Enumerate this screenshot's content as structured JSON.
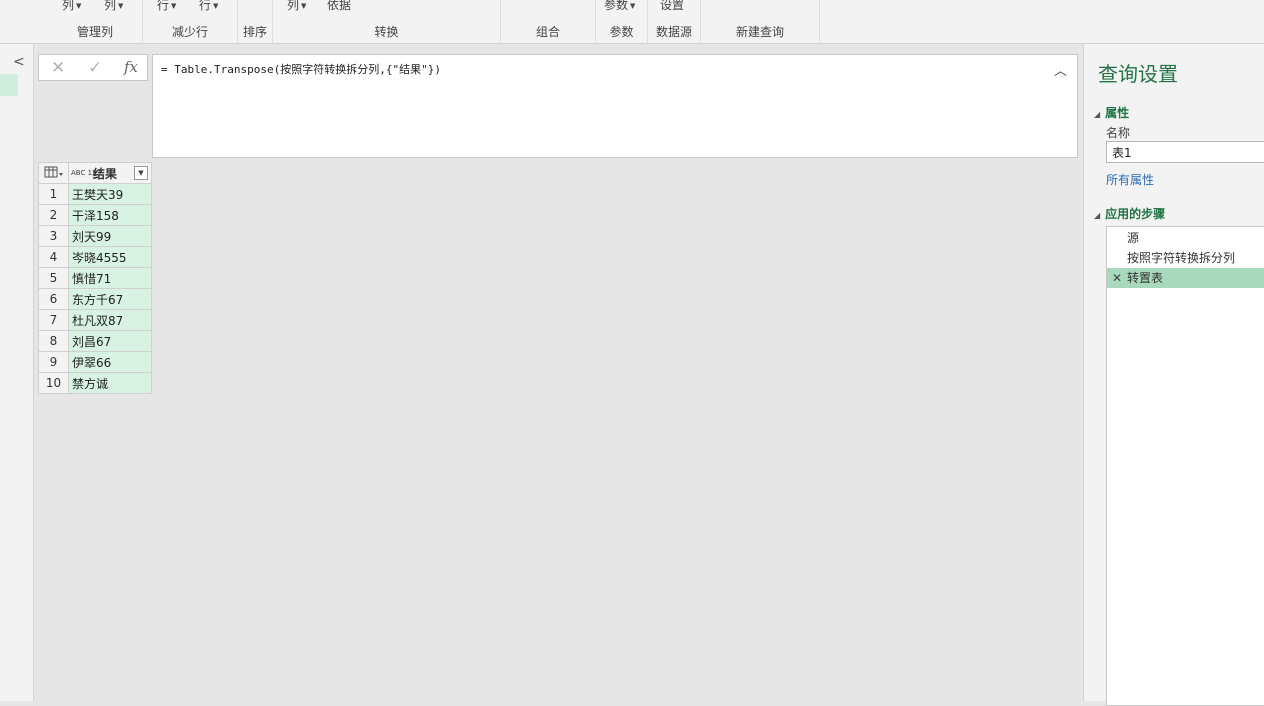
{
  "ribbon": {
    "groups": [
      {
        "label": "管理列",
        "buttons": [
          "列",
          "列"
        ]
      },
      {
        "label": "减少行",
        "buttons": [
          "行",
          "行"
        ]
      },
      {
        "label": "排序",
        "buttons": []
      },
      {
        "label": "转换",
        "buttons": [
          "列",
          "依据"
        ]
      },
      {
        "label": "组合",
        "buttons": []
      },
      {
        "label": "参数",
        "buttons": [
          "参数"
        ]
      },
      {
        "label": "数据源",
        "buttons": [
          "设置"
        ]
      },
      {
        "label": "新建查询",
        "buttons": []
      }
    ]
  },
  "formula": {
    "text": "= Table.Transpose(按照字符转换拆分列,{\"结果\"})",
    "cancel_glyph": "✕",
    "confirm_glyph": "✓",
    "fx_label": "fx"
  },
  "grid": {
    "column_type": "ABC 123",
    "column_header": "结果",
    "rows": [
      {
        "n": "1",
        "v": "王樊天39"
      },
      {
        "n": "2",
        "v": "干泽158"
      },
      {
        "n": "3",
        "v": "刘天99"
      },
      {
        "n": "4",
        "v": "岑晓4555"
      },
      {
        "n": "5",
        "v": "慎惜71"
      },
      {
        "n": "6",
        "v": "东方千67"
      },
      {
        "n": "7",
        "v": "杜凡双87"
      },
      {
        "n": "8",
        "v": "刘昌67"
      },
      {
        "n": "9",
        "v": "伊翠66"
      },
      {
        "n": "10",
        "v": "禁方诚"
      }
    ]
  },
  "query_settings": {
    "title": "查询设置",
    "properties_label": "属性",
    "name_label": "名称",
    "name_value": "表1",
    "all_properties_link": "所有属性",
    "applied_steps_label": "应用的步骤",
    "steps": [
      {
        "label": "源",
        "selected": false
      },
      {
        "label": "按照字符转换拆分列",
        "selected": false
      },
      {
        "label": "转置表",
        "selected": true
      }
    ]
  }
}
